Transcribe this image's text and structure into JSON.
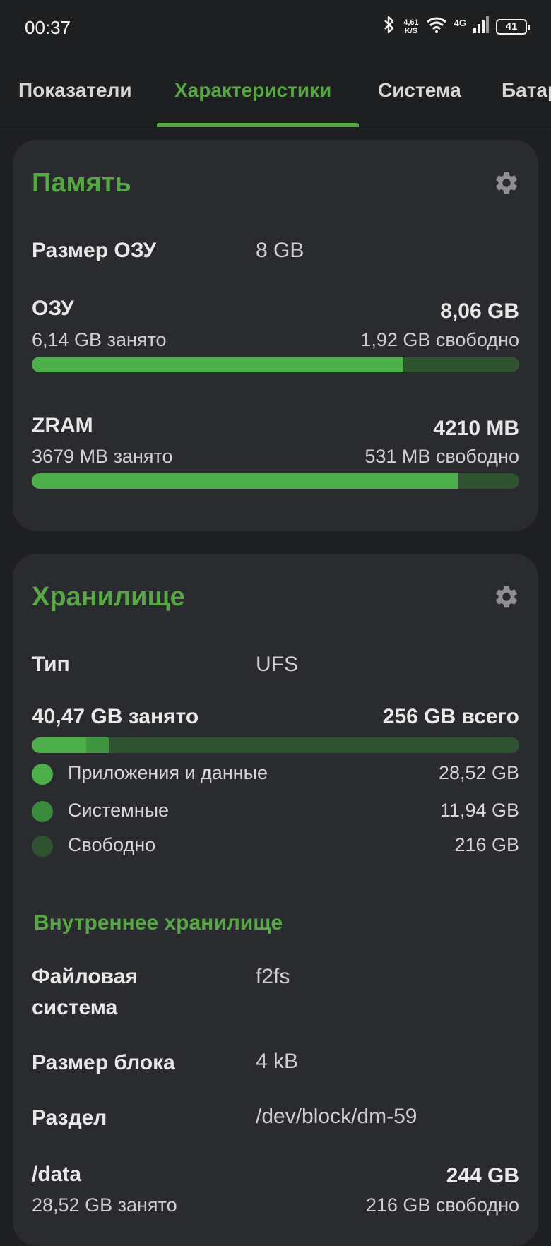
{
  "status_bar": {
    "time": "00:37",
    "net_speed_value": "4,61",
    "net_speed_unit": "K/S",
    "network_type": "4G",
    "battery": "41",
    "icons": [
      "bluetooth-icon",
      "wifi-icon",
      "signal-icon",
      "battery-icon"
    ]
  },
  "tabs": [
    {
      "label": "Показатели",
      "active": false
    },
    {
      "label": "Характеристики",
      "active": true
    },
    {
      "label": "Система",
      "active": false
    },
    {
      "label": "Батар",
      "active": false
    }
  ],
  "colors": {
    "accent": "#57a845",
    "background": "#1e1f21",
    "card": "#2a2b2e",
    "bar_track": "#2f5230",
    "bar_fill": "#4caf4a"
  },
  "memory": {
    "title": "Память",
    "ram_size_label": "Размер ОЗУ",
    "ram_size_value": "8 GB",
    "ram": {
      "name": "ОЗУ",
      "total": "8,06 GB",
      "used": "6,14 GB занято",
      "free": "1,92 GB свободно",
      "used_fraction": 0.762
    },
    "zram": {
      "name": "ZRAM",
      "total": "4210 MB",
      "used": "3679 MB занято",
      "free": "531 MB свободно",
      "used_fraction": 0.874
    }
  },
  "storage": {
    "title": "Хранилище",
    "type_label": "Тип",
    "type_value": "UFS",
    "used_label": "40,47 GB занято",
    "total_label": "256 GB всего",
    "apps_fraction": 0.111,
    "system_fraction": 0.047,
    "legend": [
      {
        "label": "Приложения и данные",
        "value": "28,52 GB",
        "color": "#4caf4a"
      },
      {
        "label": "Системные",
        "value": "11,94 GB",
        "color": "#3a8a3b"
      },
      {
        "label": "Свободно",
        "value": "216 GB",
        "color": "#2f5230"
      }
    ],
    "internal": {
      "heading": "Внутреннее хранилище",
      "fs_label_1": "Файловая",
      "fs_label_2": "система",
      "fs_value": "f2fs",
      "block_label": "Размер блока",
      "block_value": "4 kB",
      "partition_label": "Раздел",
      "partition_value": "/dev/block/dm-59",
      "data": {
        "name": "/data",
        "total": "244 GB",
        "used": "28,52 GB занято",
        "free": "216 GB свободно"
      }
    }
  }
}
